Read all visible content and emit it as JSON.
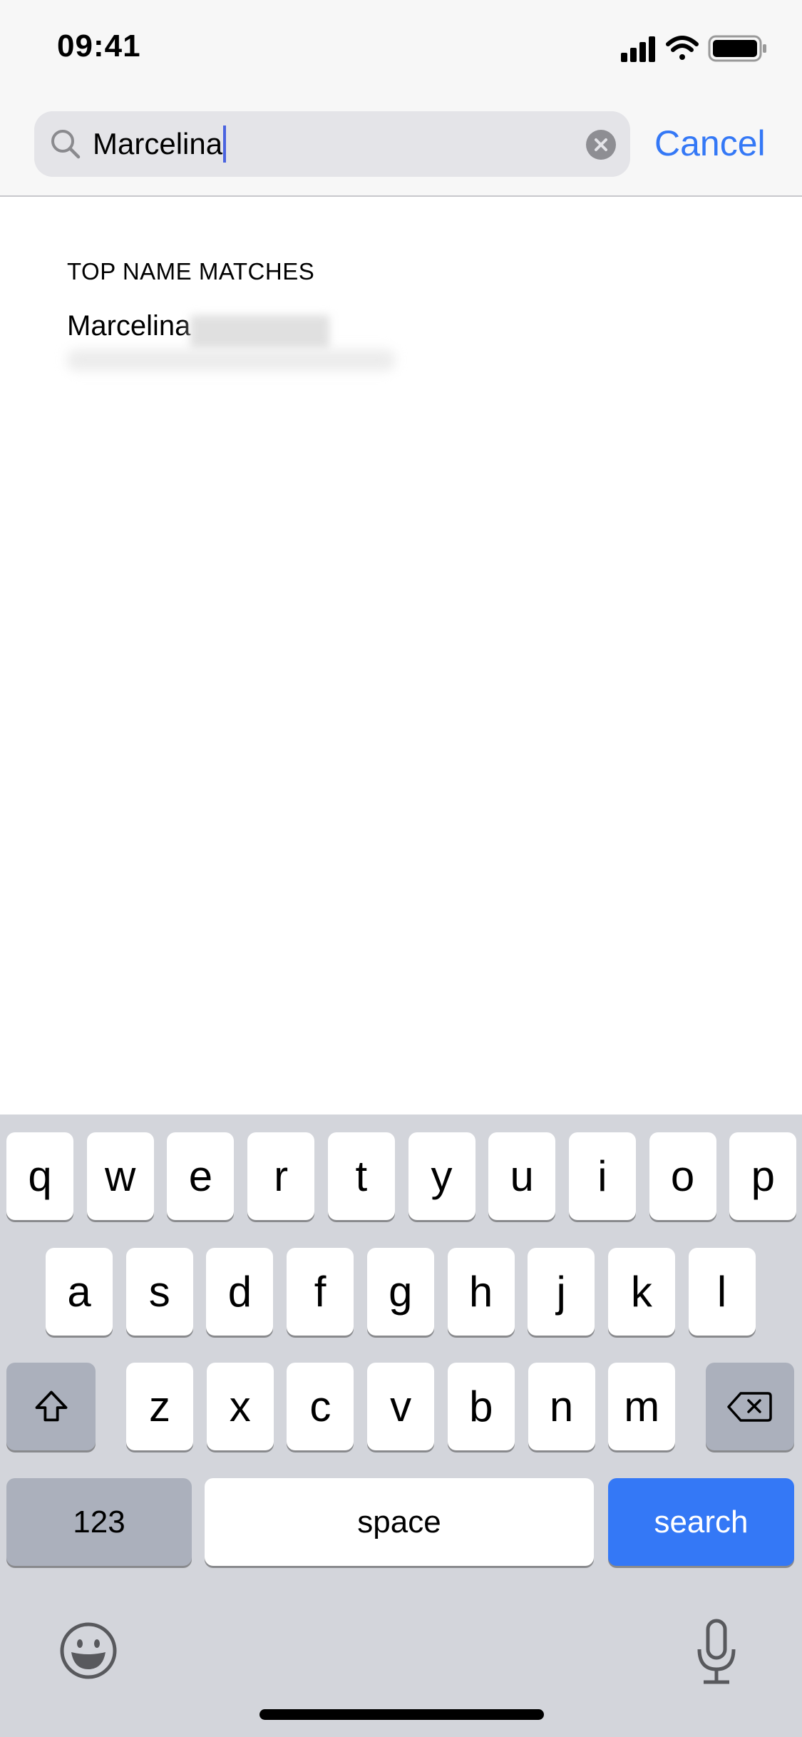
{
  "status_bar": {
    "time": "09:41",
    "icons": [
      "cellular-signal-icon",
      "wifi-icon",
      "battery-icon"
    ]
  },
  "search": {
    "value": "Marcelina",
    "cancel_label": "Cancel",
    "icon": "magnifying-glass-icon",
    "clear_icon": "clear-circle-x-icon"
  },
  "results": {
    "section_header": "TOP NAME MATCHES",
    "items": [
      {
        "name": "Marcelina"
      }
    ]
  },
  "keyboard": {
    "row1": [
      "q",
      "w",
      "e",
      "r",
      "t",
      "y",
      "u",
      "i",
      "o",
      "p"
    ],
    "row2": [
      "a",
      "s",
      "d",
      "f",
      "g",
      "h",
      "j",
      "k",
      "l"
    ],
    "row3": [
      "z",
      "x",
      "c",
      "v",
      "b",
      "n",
      "m"
    ],
    "numbers_label": "123",
    "space_label": "space",
    "return_label": "search",
    "icons": [
      "shift-icon",
      "delete-icon",
      "emoji-icon",
      "microphone-icon"
    ]
  },
  "colors": {
    "accent": "#3478f6",
    "caret": "#4a63e0",
    "keyboard_bg": "#d3d5db",
    "search_field_bg": "#e4e4e8"
  }
}
